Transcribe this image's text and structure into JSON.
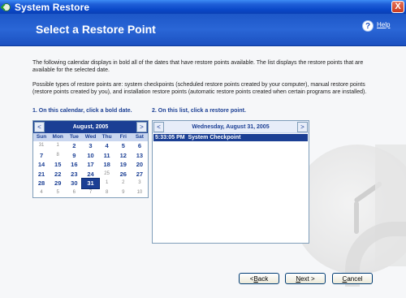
{
  "window": {
    "title": "System Restore",
    "close_glyph": "X"
  },
  "header": {
    "title": "Select a Restore Point",
    "help_label": "Help",
    "help_glyph": "?"
  },
  "description": {
    "paragraph1": "The following calendar displays in bold all of the dates that have restore points available. The list displays the restore points that are available for the selected date.",
    "paragraph2": "Possible types of restore points are: system checkpoints (scheduled restore points created by your computer), manual restore points (restore points created by you), and installation restore points (automatic restore points created when certain programs are installed)."
  },
  "steps": {
    "step1": "1. On this calendar, click a bold date.",
    "step2": "2. On this list, click a restore point."
  },
  "calendar": {
    "month_label": "August, 2005",
    "prev_glyph": "<",
    "next_glyph": ">",
    "days_of_week": [
      "Sun",
      "Mon",
      "Tue",
      "Wed",
      "Thu",
      "Fri",
      "Sat"
    ],
    "days": [
      {
        "d": "31",
        "muted": true
      },
      {
        "d": "1",
        "muted": true
      },
      {
        "d": "2"
      },
      {
        "d": "3"
      },
      {
        "d": "4"
      },
      {
        "d": "5"
      },
      {
        "d": "6"
      },
      {
        "d": "7"
      },
      {
        "d": "8",
        "muted": true
      },
      {
        "d": "9"
      },
      {
        "d": "10"
      },
      {
        "d": "11"
      },
      {
        "d": "12"
      },
      {
        "d": "13"
      },
      {
        "d": "14"
      },
      {
        "d": "15"
      },
      {
        "d": "16"
      },
      {
        "d": "17"
      },
      {
        "d": "18"
      },
      {
        "d": "19"
      },
      {
        "d": "20"
      },
      {
        "d": "21"
      },
      {
        "d": "22"
      },
      {
        "d": "23"
      },
      {
        "d": "24"
      },
      {
        "d": "25",
        "muted": true
      },
      {
        "d": "26"
      },
      {
        "d": "27"
      },
      {
        "d": "28"
      },
      {
        "d": "29"
      },
      {
        "d": "30"
      },
      {
        "d": "31",
        "selected": true
      },
      {
        "d": "1",
        "muted": true
      },
      {
        "d": "2",
        "muted": true
      },
      {
        "d": "3",
        "muted": true
      },
      {
        "d": "4",
        "muted": true
      },
      {
        "d": "5",
        "muted": true
      },
      {
        "d": "6",
        "muted": true
      },
      {
        "d": "7",
        "muted": true
      },
      {
        "d": "8",
        "muted": true
      },
      {
        "d": "9",
        "muted": true
      },
      {
        "d": "10",
        "muted": true
      }
    ]
  },
  "restore_list": {
    "date_label": "Wednesday, August 31, 2005",
    "prev_glyph": "<",
    "next_glyph": ">",
    "items": [
      {
        "time": "5:33:05 PM",
        "description": "System Checkpoint",
        "selected": true
      }
    ]
  },
  "buttons": {
    "back": {
      "prefix": "< ",
      "accel": "B",
      "rest": "ack"
    },
    "next": {
      "accel": "N",
      "rest": "ext >"
    },
    "cancel": {
      "accel": "C",
      "rest": "ancel"
    }
  },
  "colors": {
    "accent": "#1b3f94",
    "banner": "#2a66d6",
    "selection": "#1b3f94"
  }
}
